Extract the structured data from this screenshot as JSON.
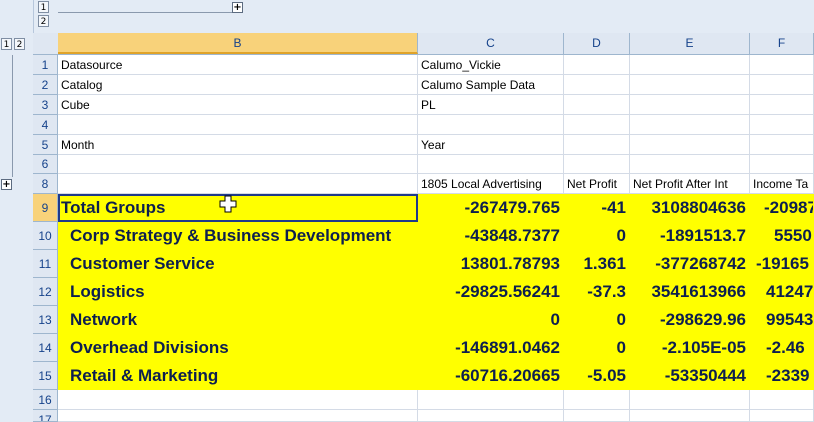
{
  "outline": {
    "levels": [
      "1",
      "2"
    ],
    "expand_symbol": "+"
  },
  "columns": [
    "B",
    "C",
    "D",
    "E",
    "F"
  ],
  "rows": [
    {
      "num": "1",
      "b": "Datasource",
      "c": "Calumo_Vickie",
      "d": "",
      "e": "",
      "f": ""
    },
    {
      "num": "2",
      "b": "Catalog",
      "c": "Calumo Sample Data",
      "d": "",
      "e": "",
      "f": ""
    },
    {
      "num": "3",
      "b": "Cube",
      "c": "PL",
      "d": "",
      "e": "",
      "f": ""
    },
    {
      "num": "4",
      "b": "",
      "c": "",
      "d": "",
      "e": "",
      "f": ""
    },
    {
      "num": "5",
      "b": "Month",
      "c": "Year",
      "d": "",
      "e": "",
      "f": ""
    },
    {
      "num": "6",
      "b": "",
      "c": "",
      "d": "",
      "e": "",
      "f": ""
    },
    {
      "num": "8",
      "b": "",
      "c": "1805 Local Advertising",
      "d": "Net Profit",
      "e": "Net Profit After Int",
      "f": "Income Ta"
    },
    {
      "num": "9",
      "b": "Total Groups",
      "c": "-267479.765",
      "d": "-41",
      "e": "3108804636",
      "f": "-20987"
    },
    {
      "num": "10",
      "b": "Corp Strategy & Business Development",
      "c": "-43848.7377",
      "d": "0",
      "e": "-1891513.7",
      "f": "5550."
    },
    {
      "num": "11",
      "b": "Customer Service",
      "c": "13801.78793",
      "d": "1.361",
      "e": "-377268742",
      "f": "-19165"
    },
    {
      "num": "12",
      "b": "Logistics",
      "c": "-29825.56241",
      "d": "-37.3",
      "e": "3541613966",
      "f": "41247"
    },
    {
      "num": "13",
      "b": "Network",
      "c": "0",
      "d": "0",
      "e": "-298629.96",
      "f": "99543"
    },
    {
      "num": "14",
      "b": "Overhead Divisions",
      "c": "-146891.0462",
      "d": "0",
      "e": "-2.105E-05",
      "f": "-2.46"
    },
    {
      "num": "15",
      "b": "Retail & Marketing",
      "c": "-60716.20665",
      "d": "-5.05",
      "e": "-53350444",
      "f": "-2339"
    },
    {
      "num": "16",
      "b": "",
      "c": "",
      "d": "",
      "e": "",
      "f": ""
    },
    {
      "num": "17",
      "b": "",
      "c": "",
      "d": "",
      "e": "",
      "f": ""
    }
  ],
  "colors": {
    "highlight": "#ffff00",
    "header_bg": "#dfe7f2",
    "selected_header": "#f8d27a",
    "data_text": "#0d1f4f"
  }
}
